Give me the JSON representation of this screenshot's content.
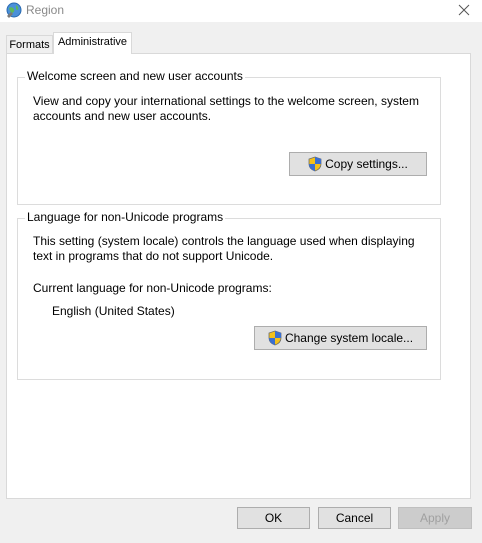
{
  "window": {
    "title": "Region",
    "close_icon": "close-icon",
    "app_icon": "globe-icon"
  },
  "tabs": [
    {
      "label": "Formats",
      "selected": false
    },
    {
      "label": "Administrative",
      "selected": true
    }
  ],
  "welcome_group": {
    "legend": "Welcome screen and new user accounts",
    "description_line1": "View and copy your international settings to the welcome screen, system",
    "description_line2": "accounts and new user accounts.",
    "copy_button": "Copy settings..."
  },
  "unicode_group": {
    "legend": "Language for non-Unicode programs",
    "description_line1": "This setting (system locale) controls the language used when displaying",
    "description_line2": "text in programs that do not support Unicode.",
    "current_label": "Current language for non-Unicode programs:",
    "current_value": "English (United States)",
    "change_button": "Change system locale..."
  },
  "footer": {
    "ok": "OK",
    "cancel": "Cancel",
    "apply": "Apply"
  },
  "icons": {
    "shield": "uac-shield-icon"
  },
  "colors": {
    "window_bg": "#f0f0f0",
    "button_bg": "#e1e1e1",
    "button_border": "#adadad",
    "title_text": "#8a8a8a"
  }
}
